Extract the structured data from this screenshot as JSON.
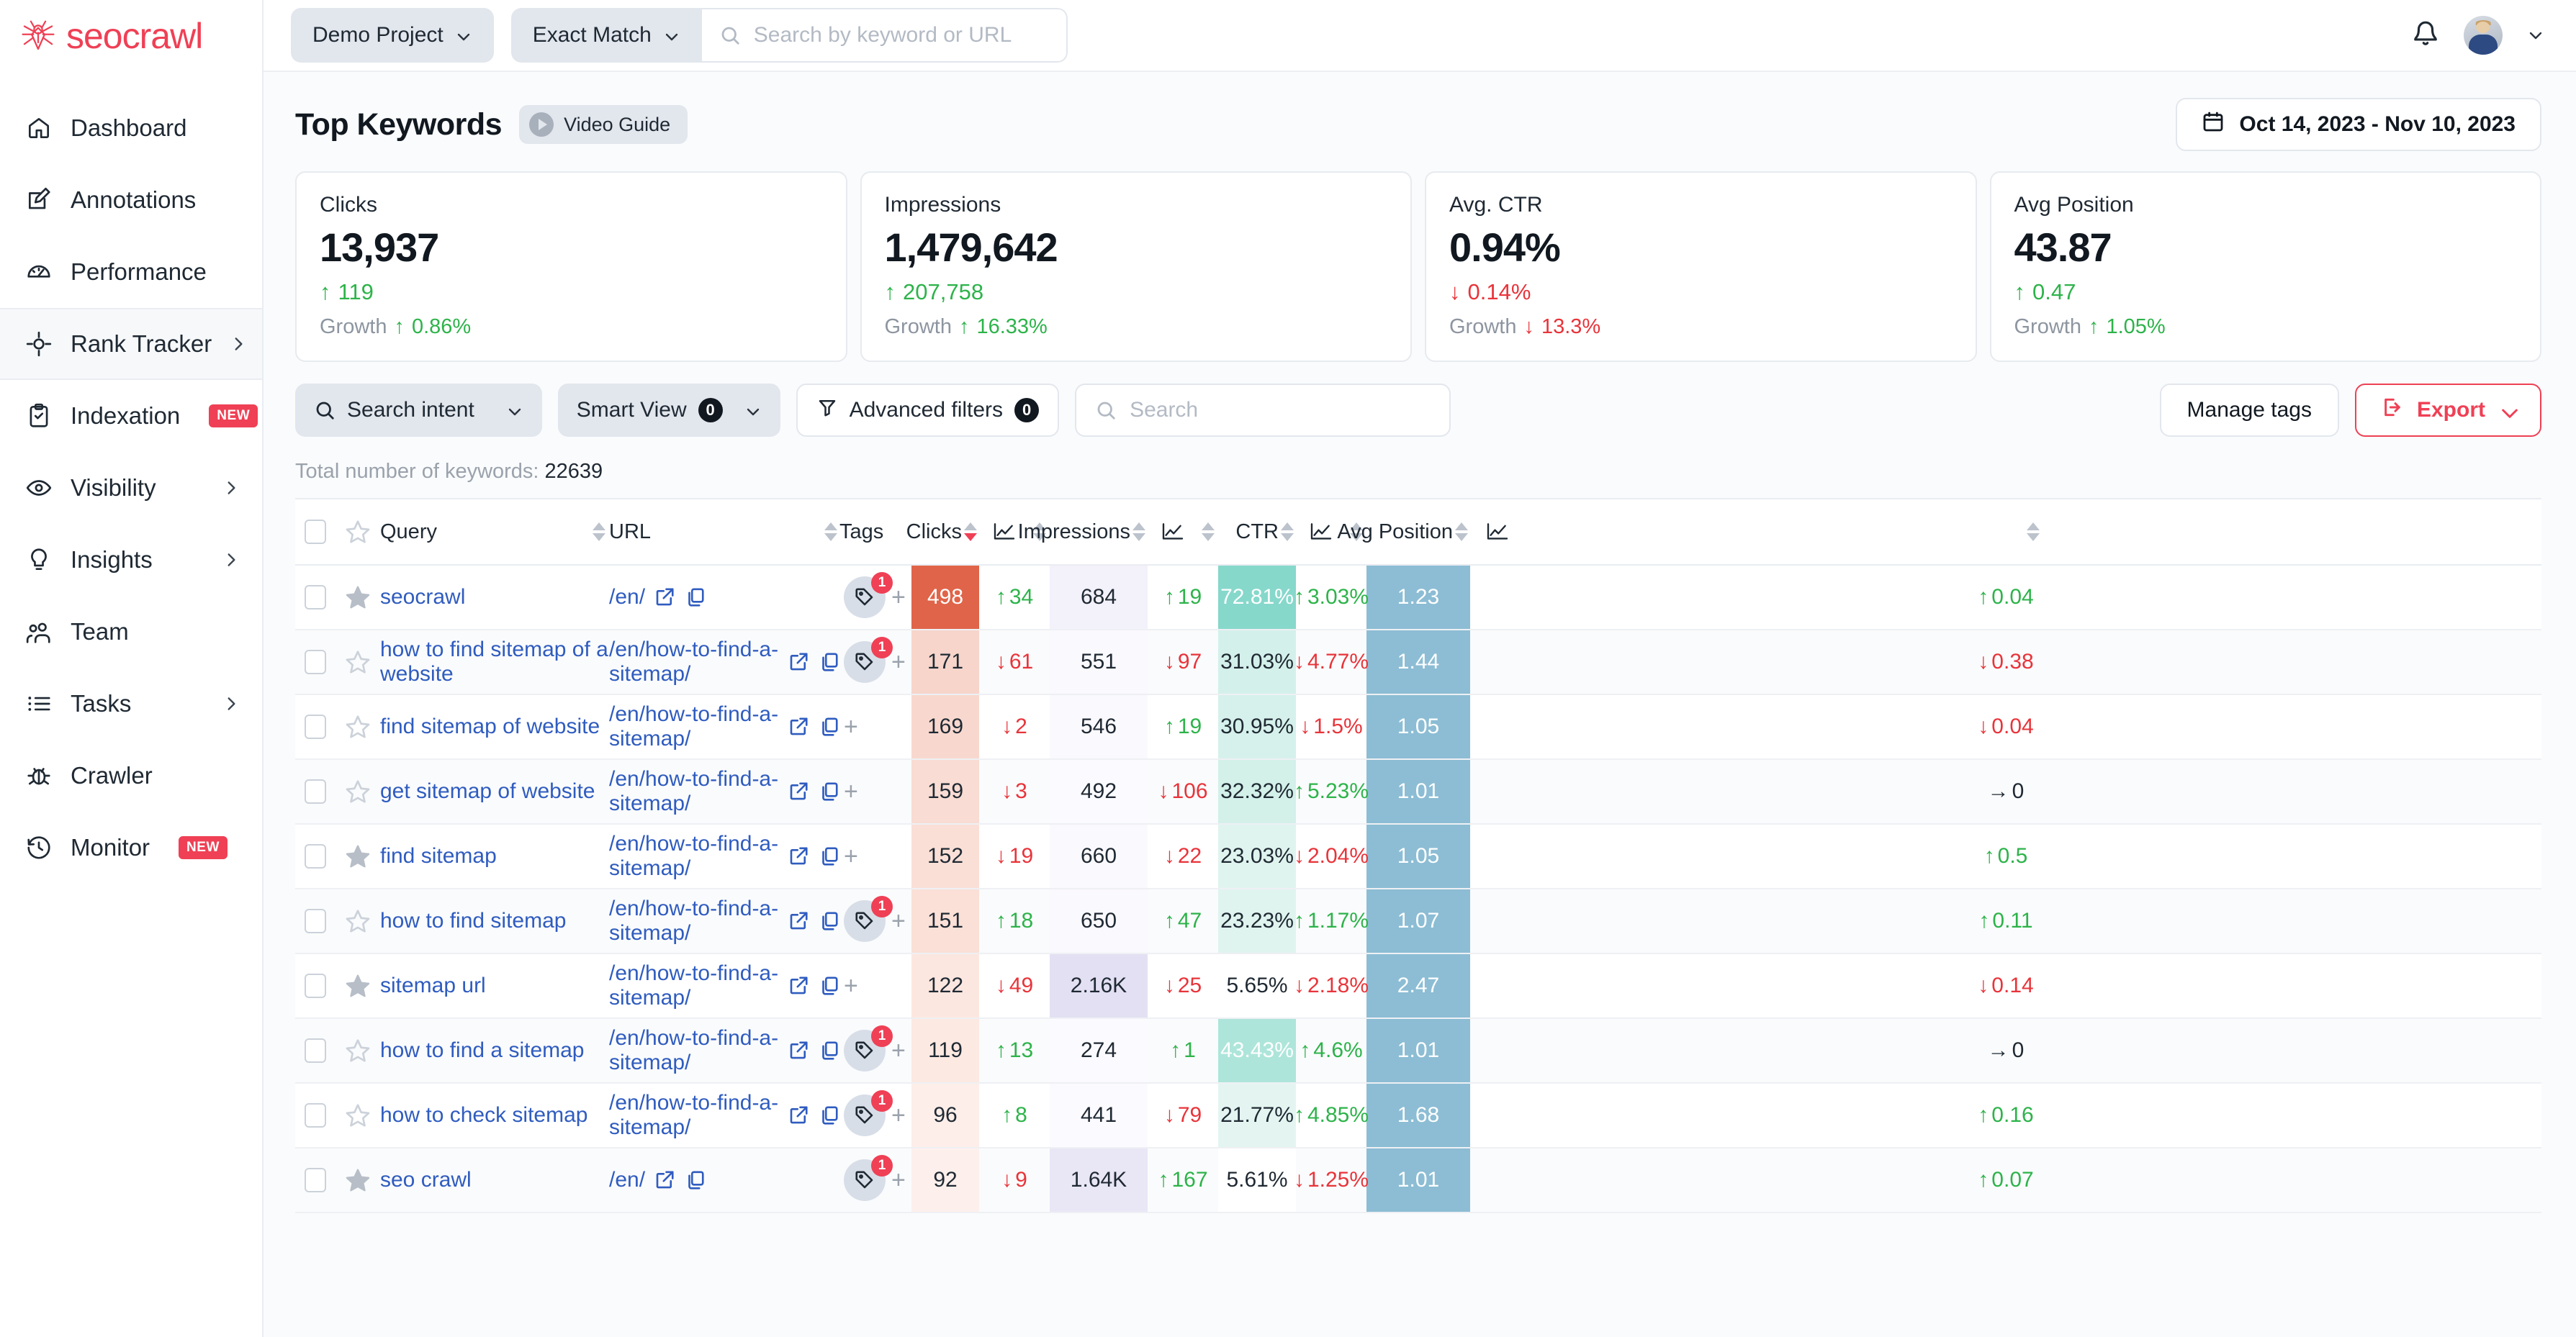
{
  "brand": {
    "name": "seocrawl",
    "color": "#ef4055"
  },
  "sidebar": {
    "items": [
      {
        "label": "Dashboard",
        "icon": "home-icon",
        "chevron": false,
        "badge": null,
        "active": false
      },
      {
        "label": "Annotations",
        "icon": "edit-icon",
        "chevron": false,
        "badge": null,
        "active": false
      },
      {
        "label": "Performance",
        "icon": "gauge-icon",
        "chevron": false,
        "badge": null,
        "active": false
      },
      {
        "label": "Rank Tracker",
        "icon": "target-icon",
        "chevron": true,
        "badge": null,
        "active": true
      },
      {
        "label": "Indexation",
        "icon": "clipboard-icon",
        "chevron": false,
        "badge": "NEW",
        "active": false
      },
      {
        "label": "Visibility",
        "icon": "eye-icon",
        "chevron": true,
        "badge": null,
        "active": false
      },
      {
        "label": "Insights",
        "icon": "bulb-icon",
        "chevron": true,
        "badge": null,
        "active": false
      },
      {
        "label": "Team",
        "icon": "users-icon",
        "chevron": false,
        "badge": null,
        "active": false
      },
      {
        "label": "Tasks",
        "icon": "list-icon",
        "chevron": true,
        "badge": null,
        "active": false
      },
      {
        "label": "Crawler",
        "icon": "bug-icon",
        "chevron": false,
        "badge": null,
        "active": false
      },
      {
        "label": "Monitor",
        "icon": "clock-icon",
        "chevron": false,
        "badge": "NEW",
        "active": false
      }
    ]
  },
  "topbar": {
    "project_selector": "Demo Project",
    "match_selector": "Exact Match",
    "search_placeholder": "Search by keyword or URL",
    "notification_icon": "bell-icon",
    "avatar_icon": "avatar",
    "account_chevron": "chevron-down-icon"
  },
  "page": {
    "title": "Top Keywords",
    "video_guide": "Video Guide",
    "date_range": "Oct 14, 2023 - Nov 10, 2023"
  },
  "kpis": [
    {
      "label": "Clicks",
      "value": "13,937",
      "delta": "119",
      "delta_dir": "up",
      "growth_label": "Growth",
      "growth": "0.86%",
      "growth_dir": "up"
    },
    {
      "label": "Impressions",
      "value": "1,479,642",
      "delta": "207,758",
      "delta_dir": "up",
      "growth_label": "Growth",
      "growth": "16.33%",
      "growth_dir": "up"
    },
    {
      "label": "Avg. CTR",
      "value": "0.94%",
      "delta": "0.14%",
      "delta_dir": "down",
      "growth_label": "Growth",
      "growth": "13.3%",
      "growth_dir": "down"
    },
    {
      "label": "Avg Position",
      "value": "43.87",
      "delta": "0.47",
      "delta_dir": "up",
      "growth_label": "Growth",
      "growth": "1.05%",
      "growth_dir": "up"
    }
  ],
  "filters": {
    "search_intent": "Search intent",
    "smart_view": "Smart View",
    "smart_view_count": "0",
    "advanced_filters": "Advanced filters",
    "advanced_filters_count": "0",
    "search_placeholder": "Search",
    "manage_tags": "Manage tags",
    "export": "Export"
  },
  "totals": {
    "label": "Total number of keywords:",
    "value": "22639"
  },
  "table": {
    "columns": [
      "Query",
      "URL",
      "Tags",
      "Clicks",
      "Impressions",
      "CTR",
      "Avg Position"
    ],
    "sorted_column": "Clicks",
    "sort_direction": "desc",
    "rows": [
      {
        "starred": true,
        "query": "seocrawl",
        "url": "/en/",
        "tags": 1,
        "clicks": "498",
        "clicks_delta": "34",
        "clicks_dir": "up",
        "impressions": "684",
        "impr_delta": "19",
        "impr_dir": "up",
        "ctr": "72.81%",
        "ctr_delta": "3.03%",
        "ctr_dir": "up",
        "pos": "1.23",
        "pos_delta": "0.04",
        "pos_dir": "up",
        "clicks_heat": "#e06449",
        "clicks_text": "#ffffff",
        "impr_heat": "#f3f1fa",
        "ctr_heat": "#86d8cb",
        "ctr_text": "#ffffff",
        "pos_heat": "#8cbdd4",
        "pos_text": "#ffffff"
      },
      {
        "starred": false,
        "query": "how to find sitemap of a website",
        "url": "/en/how-to-find-a-sitemap/",
        "tags": 1,
        "clicks": "171",
        "clicks_delta": "61",
        "clicks_dir": "down",
        "impressions": "551",
        "impr_delta": "97",
        "impr_dir": "down",
        "ctr": "31.03%",
        "ctr_delta": "4.77%",
        "ctr_dir": "down",
        "pos": "1.44",
        "pos_delta": "0.38",
        "pos_dir": "down",
        "clicks_heat": "#f7d5cb",
        "clicks_text": "#1f2933",
        "impr_heat": "#faf9fd",
        "ctr_heat": "#d4f0ea",
        "ctr_text": "#1f2933",
        "pos_heat": "#8cbdd4",
        "pos_text": "#ffffff"
      },
      {
        "starred": false,
        "query": "find sitemap of website",
        "url": "/en/how-to-find-a-sitemap/",
        "tags": 0,
        "clicks": "169",
        "clicks_delta": "2",
        "clicks_dir": "down",
        "impressions": "546",
        "impr_delta": "19",
        "impr_dir": "up",
        "ctr": "30.95%",
        "ctr_delta": "1.5%",
        "ctr_dir": "down",
        "pos": "1.05",
        "pos_delta": "0.04",
        "pos_dir": "down",
        "clicks_heat": "#f8d8ce",
        "clicks_text": "#1f2933",
        "impr_heat": "#faf9fd",
        "ctr_heat": "#d6f1eb",
        "ctr_text": "#1f2933",
        "pos_heat": "#8cbdd4",
        "pos_text": "#ffffff"
      },
      {
        "starred": false,
        "query": "get sitemap of website",
        "url": "/en/how-to-find-a-sitemap/",
        "tags": 0,
        "clicks": "159",
        "clicks_delta": "3",
        "clicks_dir": "down",
        "impressions": "492",
        "impr_delta": "106",
        "impr_dir": "down",
        "ctr": "32.32%",
        "ctr_delta": "5.23%",
        "ctr_dir": "up",
        "pos": "1.01",
        "pos_delta": "0",
        "pos_dir": "flat",
        "clicks_heat": "#f9dcd3",
        "clicks_text": "#1f2933",
        "impr_heat": "#fbfafe",
        "ctr_heat": "#d3f0e9",
        "ctr_text": "#1f2933",
        "pos_heat": "#8cbdd4",
        "pos_text": "#ffffff"
      },
      {
        "starred": true,
        "query": "find sitemap",
        "url": "/en/how-to-find-a-sitemap/",
        "tags": 0,
        "clicks": "152",
        "clicks_delta": "19",
        "clicks_dir": "down",
        "impressions": "660",
        "impr_delta": "22",
        "impr_dir": "down",
        "ctr": "23.03%",
        "ctr_delta": "2.04%",
        "ctr_dir": "down",
        "pos": "1.05",
        "pos_delta": "0.5",
        "pos_dir": "up",
        "clicks_heat": "#fadfd6",
        "clicks_text": "#1f2933",
        "impr_heat": "#faf9fd",
        "ctr_heat": "#e0f4ef",
        "ctr_text": "#1f2933",
        "pos_heat": "#8cbdd4",
        "pos_text": "#ffffff"
      },
      {
        "starred": false,
        "query": "how to find sitemap",
        "url": "/en/how-to-find-a-sitemap/",
        "tags": 1,
        "clicks": "151",
        "clicks_delta": "18",
        "clicks_dir": "up",
        "impressions": "650",
        "impr_delta": "47",
        "impr_dir": "up",
        "ctr": "23.23%",
        "ctr_delta": "1.17%",
        "ctr_dir": "up",
        "pos": "1.07",
        "pos_delta": "0.11",
        "pos_dir": "up",
        "clicks_heat": "#fae0d7",
        "clicks_text": "#1f2933",
        "impr_heat": "#faf9fd",
        "ctr_heat": "#e0f4ef",
        "ctr_text": "#1f2933",
        "pos_heat": "#8cbdd4",
        "pos_text": "#ffffff"
      },
      {
        "starred": true,
        "query": "sitemap url",
        "url": "/en/how-to-find-a-sitemap/",
        "tags": 0,
        "clicks": "122",
        "clicks_delta": "49",
        "clicks_dir": "down",
        "impressions": "2.16K",
        "impr_delta": "25",
        "impr_dir": "down",
        "ctr": "5.65%",
        "ctr_delta": "2.18%",
        "ctr_dir": "down",
        "pos": "2.47",
        "pos_delta": "0.14",
        "pos_dir": "down",
        "clicks_heat": "#fce7e0",
        "clicks_text": "#1f2933",
        "impr_heat": "#e3e0f3",
        "ctr_heat": "#ffffff",
        "ctr_text": "#1f2933",
        "pos_heat": "#8cbdd4",
        "pos_text": "#ffffff"
      },
      {
        "starred": false,
        "query": "how to find a sitemap",
        "url": "/en/how-to-find-a-sitemap/",
        "tags": 1,
        "clicks": "119",
        "clicks_delta": "13",
        "clicks_dir": "up",
        "impressions": "274",
        "impr_delta": "1",
        "impr_dir": "up",
        "ctr": "43.43%",
        "ctr_delta": "4.6%",
        "ctr_dir": "up",
        "pos": "1.01",
        "pos_delta": "0",
        "pos_dir": "flat",
        "clicks_heat": "#fce9e2",
        "clicks_text": "#1f2933",
        "impr_heat": "#fbfafe",
        "ctr_heat": "#aee5da",
        "ctr_text": "#ffffff",
        "pos_heat": "#8cbdd4",
        "pos_text": "#ffffff"
      },
      {
        "starred": false,
        "query": "how to check sitemap",
        "url": "/en/how-to-find-a-sitemap/",
        "tags": 1,
        "clicks": "96",
        "clicks_delta": "8",
        "clicks_dir": "up",
        "impressions": "441",
        "impr_delta": "79",
        "impr_dir": "down",
        "ctr": "21.77%",
        "ctr_delta": "4.85%",
        "ctr_dir": "up",
        "pos": "1.68",
        "pos_delta": "0.16",
        "pos_dir": "up",
        "clicks_heat": "#fdeee9",
        "clicks_text": "#1f2933",
        "impr_heat": "#fbfafe",
        "ctr_heat": "#e4f5f1",
        "ctr_text": "#1f2933",
        "pos_heat": "#8cbdd4",
        "pos_text": "#ffffff"
      },
      {
        "starred": true,
        "query": "seo crawl",
        "url": "/en/",
        "tags": 1,
        "clicks": "92",
        "clicks_delta": "9",
        "clicks_dir": "down",
        "impressions": "1.64K",
        "impr_delta": "167",
        "impr_dir": "up",
        "ctr": "5.61%",
        "ctr_delta": "1.25%",
        "ctr_dir": "down",
        "pos": "1.01",
        "pos_delta": "0.07",
        "pos_dir": "up",
        "clicks_heat": "#fdf0ec",
        "clicks_text": "#1f2933",
        "impr_heat": "#e9e6f6",
        "ctr_heat": "#ffffff",
        "ctr_text": "#1f2933",
        "pos_heat": "#8cbdd4",
        "pos_text": "#ffffff"
      }
    ]
  }
}
